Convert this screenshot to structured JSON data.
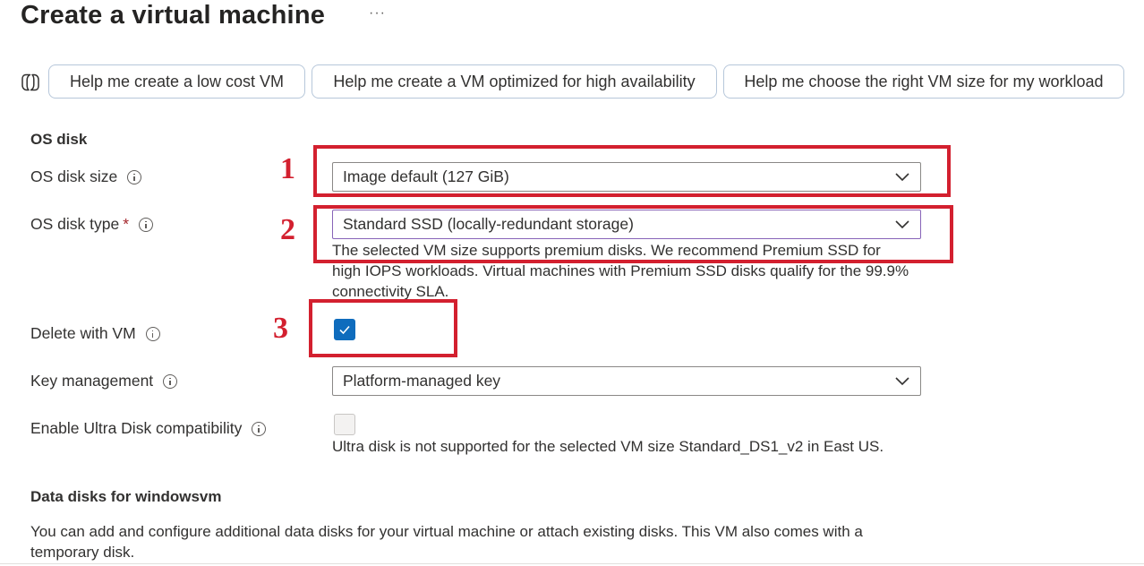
{
  "header": {
    "title": "Create a virtual machine",
    "more_label": "···"
  },
  "copilot": {
    "icon": "copilot-icon",
    "prompts": [
      "Help me create a low cost VM",
      "Help me create a VM optimized for high availability",
      "Help me choose the right VM size for my workload"
    ]
  },
  "os_disk": {
    "section_title": "OS disk",
    "disk_size": {
      "label": "OS disk size",
      "value": "Image default (127 GiB)"
    },
    "disk_type": {
      "label": "OS disk type",
      "required_marker": "*",
      "value": "Standard SSD (locally-redundant storage)",
      "help_lines": [
        "The selected VM size supports premium disks. We recommend Premium SSD for",
        "high IOPS workloads. Virtual machines with Premium SSD disks qualify for the 99.9%",
        "connectivity SLA."
      ]
    },
    "delete_with_vm": {
      "label": "Delete with VM",
      "checked": true
    },
    "key_management": {
      "label": "Key management",
      "value": "Platform-managed key"
    },
    "ultra_disk": {
      "label": "Enable Ultra Disk compatibility",
      "checked": false,
      "disabled": true,
      "help": "Ultra disk is not supported for the selected VM size Standard_DS1_v2 in East US."
    }
  },
  "data_disks": {
    "section_title": "Data disks for windowsvm",
    "description_lines": [
      "You can add and configure additional data disks for your virtual machine or attach existing disks. This VM also comes with a",
      "temporary disk."
    ]
  },
  "annotations": {
    "color": "#d3202f",
    "labels": [
      "1",
      "2",
      "3"
    ]
  },
  "colors": {
    "checkbox_checked": "#0f6cbd",
    "required": "#a4262c",
    "focused_border": "#8764b8"
  }
}
